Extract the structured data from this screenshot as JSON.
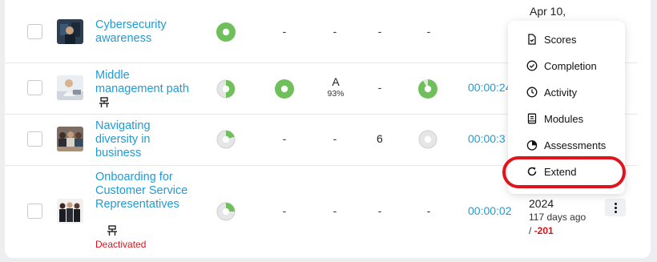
{
  "rows": [
    {
      "title": "Cybersecurity awareness",
      "completion": 1.0,
      "scores_col": "-",
      "grade_col": "-",
      "count_col": "-",
      "extra_col": "-",
      "date": "Apr 10,"
    },
    {
      "title": "Middle management path",
      "completion": 0.5,
      "completion2": 1.0,
      "grade": "A",
      "grade_pct": "93%",
      "count_col": "-",
      "progress3": 0.9,
      "duration": "00:00:24"
    },
    {
      "title": "Navigating diversity in business",
      "completion": 0.2,
      "scores_col": "-",
      "grade_col": "-",
      "count": "6",
      "progress3": 0.0,
      "duration": "00:00:3"
    },
    {
      "title": "Onboarding for Customer Service Representatives",
      "completion": 0.25,
      "scores_col": "-",
      "grade_col": "-",
      "count_col": "-",
      "extra_col": "-",
      "duration": "00:00:02",
      "status": "Deactivated",
      "year": "2024",
      "days_ago": "117 days ago",
      "slash": "/",
      "delta": "-201"
    }
  ],
  "menu": {
    "items": [
      {
        "label": "Scores",
        "icon": "file-check-icon"
      },
      {
        "label": "Completion",
        "icon": "check-circle-icon"
      },
      {
        "label": "Activity",
        "icon": "clock-icon"
      },
      {
        "label": "Modules",
        "icon": "book-icon"
      },
      {
        "label": "Assessments",
        "icon": "pie-chart-icon"
      },
      {
        "label": "Extend",
        "icon": "refresh-icon"
      }
    ],
    "highlighted": "Extend"
  },
  "colors": {
    "accent": "#1f9bd6",
    "progress_green": "#6fbf5a",
    "progress_gray": "#d9d9d9",
    "danger": "#d7141a",
    "highlight_ring": "#e0141c"
  }
}
